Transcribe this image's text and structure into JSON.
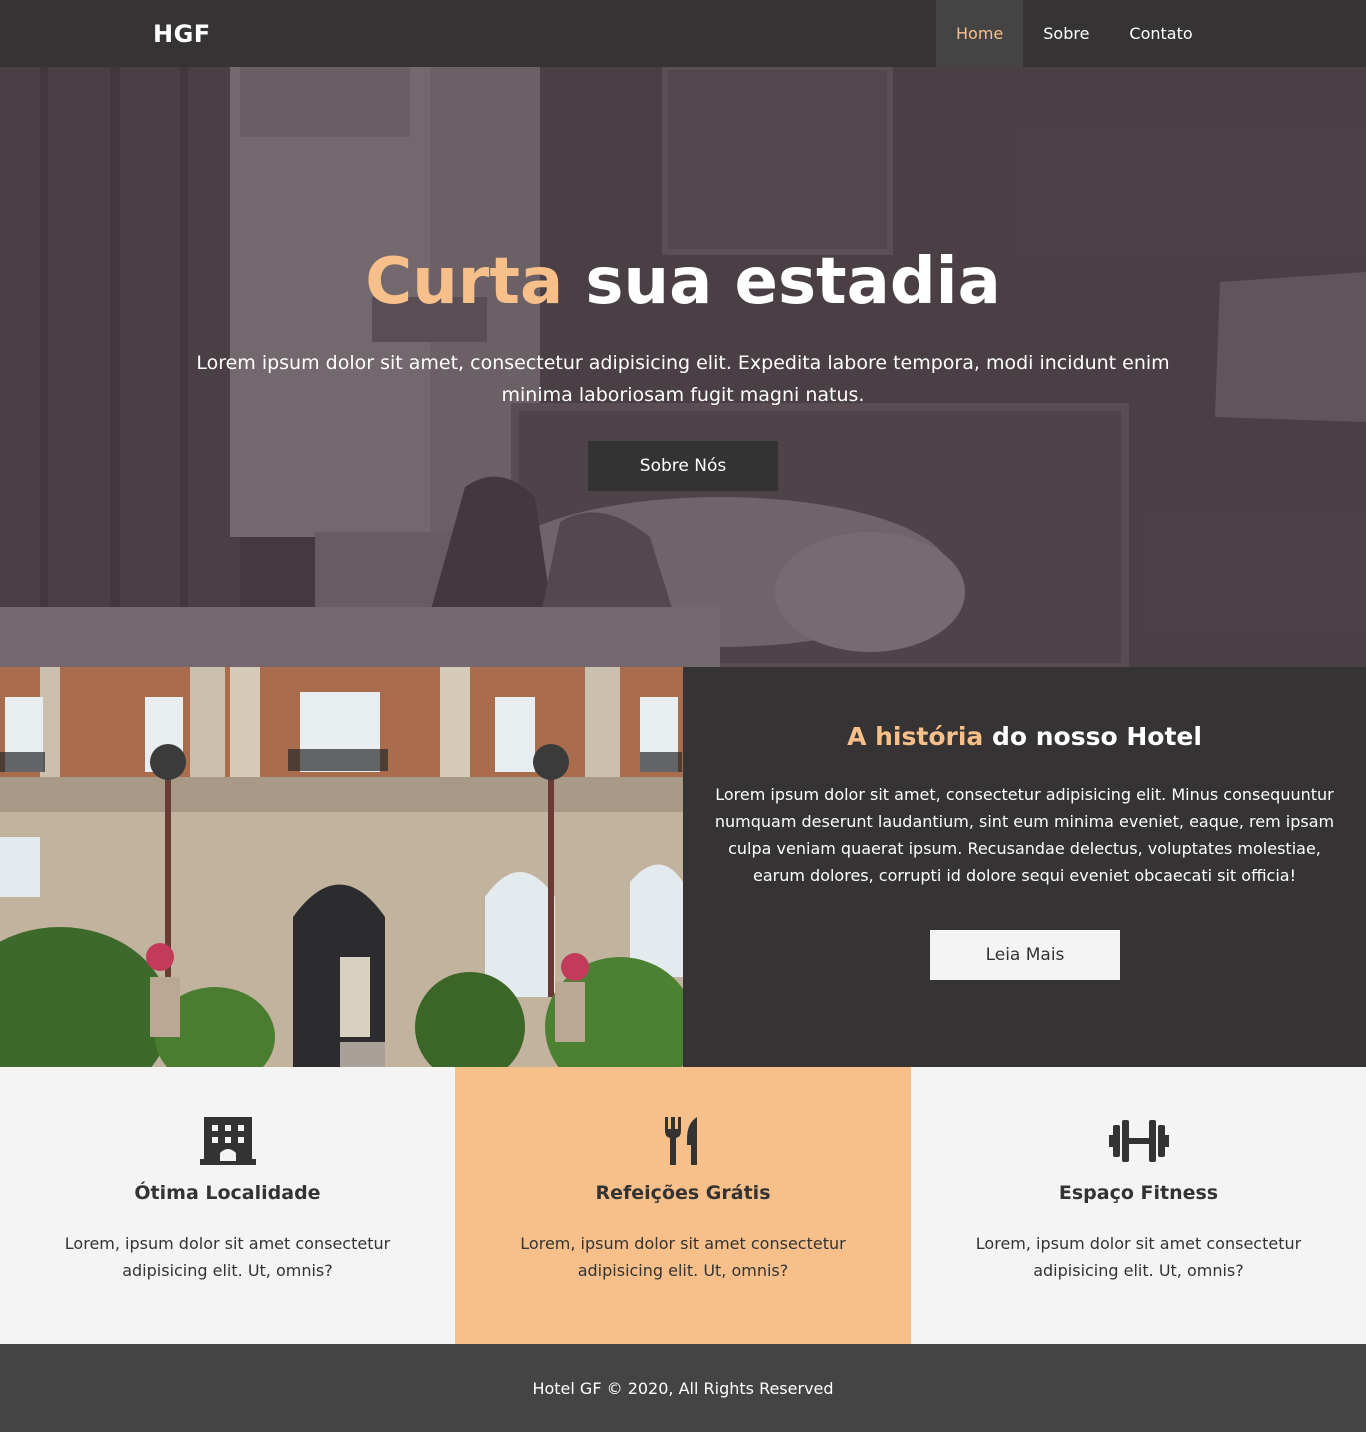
{
  "navbar": {
    "logo": "HGF",
    "items": [
      {
        "label": "Home",
        "active": true
      },
      {
        "label": "Sobre",
        "active": false
      },
      {
        "label": "Contato",
        "active": false
      }
    ]
  },
  "hero": {
    "title_accent": "Curta",
    "title_rest": " sua estadia",
    "text": "Lorem ipsum dolor sit amet, consectetur adipisicing elit. Expedita labore tempora, modi incidunt enim minima laboriosam fugit magni natus.",
    "button": "Sobre Nós"
  },
  "about": {
    "title_accent": "A história",
    "title_rest": " do nosso Hotel",
    "text": "Lorem ipsum dolor sit amet, consectetur adipisicing elit. Minus consequuntur numquam deserunt laudantium, sint eum minima eveniet, eaque, rem ipsam culpa veniam quaerat ipsum. Recusandae delectus, voluptates molestiae, earum dolores, corrupti id dolore sequi eveniet obcaecati sit officia!",
    "button": "Leia Mais"
  },
  "features": [
    {
      "icon": "building-icon",
      "title": "Ótima Localidade",
      "text": "Lorem, ipsum dolor sit amet consectetur adipisicing elit. Ut, omnis?"
    },
    {
      "icon": "utensils-icon",
      "title": "Refeições Grátis",
      "text": "Lorem, ipsum dolor sit amet consectetur adipisicing elit. Ut, omnis?"
    },
    {
      "icon": "dumbbell-icon",
      "title": "Espaço Fitness",
      "text": "Lorem, ipsum dolor sit amet consectetur adipisicing elit. Ut, omnis?"
    }
  ],
  "footer": {
    "text": "Hotel GF © 2020, All Rights Reserved"
  },
  "colors": {
    "accent": "#f7c08a",
    "dark": "#353333",
    "footer": "#444444",
    "light": "#f4f4f4"
  }
}
